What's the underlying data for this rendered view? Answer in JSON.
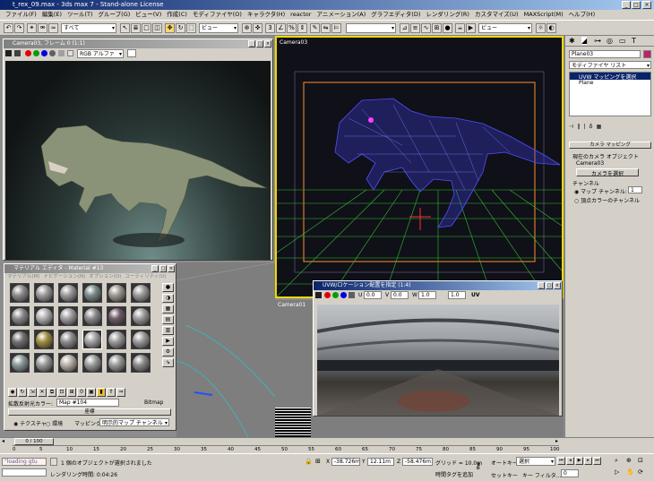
{
  "app": {
    "title": "t_rex_09.max - 3ds max 7 - Stand-alone License"
  },
  "menu": [
    "ファイル(F)",
    "編集(E)",
    "ツール(T)",
    "グループ(G)",
    "ビュー(V)",
    "作成(C)",
    "モディファイヤ(O)",
    "キャラクタ(H)",
    "reactor",
    "アニメーション(A)",
    "グラフエディタ(D)",
    "レンダリング(R)",
    "カスタマイズ(U)",
    "MAXScript(M)",
    "ヘルプ(H)"
  ],
  "toolbar": {
    "selection_filter": "すべて",
    "ref_coord": "ビュー",
    "named_selection": "",
    "view_combo": "ビュー"
  },
  "frame_window": {
    "title": "Camera03, フレーム 0 (1:1)",
    "channel": "RGB アルファ"
  },
  "camera_viewport": {
    "label": "Camera03"
  },
  "bottom_viewport": {
    "label": "Camera01"
  },
  "material_editor": {
    "title": "マテリアル エディタ - Material #13",
    "menu": [
      "マテリアル(M)",
      "ナビゲーション(N)",
      "オプション(O)",
      "ユーティリティ(U)"
    ],
    "map_label": "拡散反射光カラー:",
    "map_name": "Map #104",
    "map_type": "Bitmap",
    "rollout_title": "座標",
    "tex_radio": "テクスチャ",
    "env_radio": "環境",
    "mapping_label": "マッピング:",
    "mapping_value": "明示的マップ チャンネル",
    "sphere_colors": [
      "#8c8c8c",
      "#9a9a9a",
      "#9a9a9a",
      "#7a8a8a",
      "#a09890",
      "#9a9a9a",
      "#8a8a8a",
      "#b0b0b0",
      "#9f9f9f",
      "#8a8a8a",
      "#6e5a66",
      "#9a9a9a",
      "#707070",
      "#a08d40",
      "#8c8c8c",
      "#a0a0a0",
      "#9a9a9a",
      "#9a9a9a",
      "#8a9898",
      "#9a9a9a",
      "#b8b0a8",
      "#9a9a9a",
      "#9a9a9a",
      "#8a8a8a"
    ]
  },
  "uvw_window": {
    "title": "UVW/ロケーション配置を指定 (1:4)",
    "u_label": "U",
    "u_value": "0.0",
    "v_label": "V",
    "v_value": "0.0",
    "w_label": "W",
    "w_value": "1.0",
    "h_value": "1.0",
    "uv_label": "UV"
  },
  "command_panel": {
    "object_name": "Plane03",
    "modifier_list": "モディファイヤ リスト",
    "stack_items": [
      "UVW マッピングを選択",
      "Plane"
    ],
    "rollout1_title": "カメラ マッピング",
    "current_camera_label": "現在のカメラ オブジェクト",
    "camera_name": "Camera03",
    "select_camera_btn": "カメラを選択",
    "channel_group": "チャンネル",
    "map_channel_label": "マップ チャンネル:",
    "map_channel_value": "1",
    "vertex_color_label": "頂点カラーのチャンネル"
  },
  "timeline": {
    "frame_readout": "0 / 100",
    "ticks": [
      "0",
      "5",
      "10",
      "15",
      "20",
      "25",
      "30",
      "35",
      "40",
      "45",
      "50",
      "55",
      "60",
      "65",
      "70",
      "75",
      "80",
      "85",
      "90",
      "95",
      "100"
    ]
  },
  "status": {
    "script_text": "\"loading gtu",
    "status_line": "1 個のオブジェクトが選択されました",
    "render_time": "レンダリング時間: 0:04:26",
    "x_label": "X",
    "x_value": "-38.726m",
    "y_label": "Y",
    "y_value": "12.11m",
    "z_label": "Z",
    "z_value": "-58.476m",
    "grid": "グリッド = 10.0m",
    "add_time_tag": "時間タグを追加",
    "auto_key": "オートキー",
    "auto_key_sel": "選択",
    "set_key": "セットキー",
    "key_filter": "キー フィルタ...",
    "frame_field": "0"
  },
  "colors": {
    "title_active": "#0a246a",
    "viewport_active_border": "#f0d800",
    "wire": "#5050ff",
    "grid": "#30c030"
  }
}
